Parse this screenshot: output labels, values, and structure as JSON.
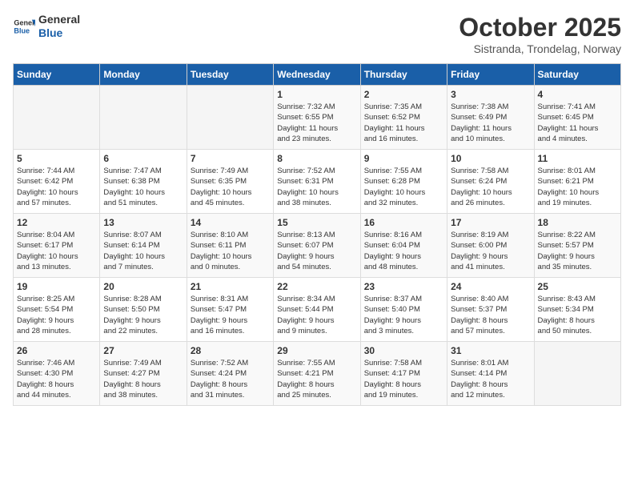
{
  "header": {
    "logo_line1": "General",
    "logo_line2": "Blue",
    "month": "October 2025",
    "location": "Sistranda, Trondelag, Norway"
  },
  "days_of_week": [
    "Sunday",
    "Monday",
    "Tuesday",
    "Wednesday",
    "Thursday",
    "Friday",
    "Saturday"
  ],
  "weeks": [
    [
      {
        "day": "",
        "content": ""
      },
      {
        "day": "",
        "content": ""
      },
      {
        "day": "",
        "content": ""
      },
      {
        "day": "1",
        "content": "Sunrise: 7:32 AM\nSunset: 6:55 PM\nDaylight: 11 hours\nand 23 minutes."
      },
      {
        "day": "2",
        "content": "Sunrise: 7:35 AM\nSunset: 6:52 PM\nDaylight: 11 hours\nand 16 minutes."
      },
      {
        "day": "3",
        "content": "Sunrise: 7:38 AM\nSunset: 6:49 PM\nDaylight: 11 hours\nand 10 minutes."
      },
      {
        "day": "4",
        "content": "Sunrise: 7:41 AM\nSunset: 6:45 PM\nDaylight: 11 hours\nand 4 minutes."
      }
    ],
    [
      {
        "day": "5",
        "content": "Sunrise: 7:44 AM\nSunset: 6:42 PM\nDaylight: 10 hours\nand 57 minutes."
      },
      {
        "day": "6",
        "content": "Sunrise: 7:47 AM\nSunset: 6:38 PM\nDaylight: 10 hours\nand 51 minutes."
      },
      {
        "day": "7",
        "content": "Sunrise: 7:49 AM\nSunset: 6:35 PM\nDaylight: 10 hours\nand 45 minutes."
      },
      {
        "day": "8",
        "content": "Sunrise: 7:52 AM\nSunset: 6:31 PM\nDaylight: 10 hours\nand 38 minutes."
      },
      {
        "day": "9",
        "content": "Sunrise: 7:55 AM\nSunset: 6:28 PM\nDaylight: 10 hours\nand 32 minutes."
      },
      {
        "day": "10",
        "content": "Sunrise: 7:58 AM\nSunset: 6:24 PM\nDaylight: 10 hours\nand 26 minutes."
      },
      {
        "day": "11",
        "content": "Sunrise: 8:01 AM\nSunset: 6:21 PM\nDaylight: 10 hours\nand 19 minutes."
      }
    ],
    [
      {
        "day": "12",
        "content": "Sunrise: 8:04 AM\nSunset: 6:17 PM\nDaylight: 10 hours\nand 13 minutes."
      },
      {
        "day": "13",
        "content": "Sunrise: 8:07 AM\nSunset: 6:14 PM\nDaylight: 10 hours\nand 7 minutes."
      },
      {
        "day": "14",
        "content": "Sunrise: 8:10 AM\nSunset: 6:11 PM\nDaylight: 10 hours\nand 0 minutes."
      },
      {
        "day": "15",
        "content": "Sunrise: 8:13 AM\nSunset: 6:07 PM\nDaylight: 9 hours\nand 54 minutes."
      },
      {
        "day": "16",
        "content": "Sunrise: 8:16 AM\nSunset: 6:04 PM\nDaylight: 9 hours\nand 48 minutes."
      },
      {
        "day": "17",
        "content": "Sunrise: 8:19 AM\nSunset: 6:00 PM\nDaylight: 9 hours\nand 41 minutes."
      },
      {
        "day": "18",
        "content": "Sunrise: 8:22 AM\nSunset: 5:57 PM\nDaylight: 9 hours\nand 35 minutes."
      }
    ],
    [
      {
        "day": "19",
        "content": "Sunrise: 8:25 AM\nSunset: 5:54 PM\nDaylight: 9 hours\nand 28 minutes."
      },
      {
        "day": "20",
        "content": "Sunrise: 8:28 AM\nSunset: 5:50 PM\nDaylight: 9 hours\nand 22 minutes."
      },
      {
        "day": "21",
        "content": "Sunrise: 8:31 AM\nSunset: 5:47 PM\nDaylight: 9 hours\nand 16 minutes."
      },
      {
        "day": "22",
        "content": "Sunrise: 8:34 AM\nSunset: 5:44 PM\nDaylight: 9 hours\nand 9 minutes."
      },
      {
        "day": "23",
        "content": "Sunrise: 8:37 AM\nSunset: 5:40 PM\nDaylight: 9 hours\nand 3 minutes."
      },
      {
        "day": "24",
        "content": "Sunrise: 8:40 AM\nSunset: 5:37 PM\nDaylight: 8 hours\nand 57 minutes."
      },
      {
        "day": "25",
        "content": "Sunrise: 8:43 AM\nSunset: 5:34 PM\nDaylight: 8 hours\nand 50 minutes."
      }
    ],
    [
      {
        "day": "26",
        "content": "Sunrise: 7:46 AM\nSunset: 4:30 PM\nDaylight: 8 hours\nand 44 minutes."
      },
      {
        "day": "27",
        "content": "Sunrise: 7:49 AM\nSunset: 4:27 PM\nDaylight: 8 hours\nand 38 minutes."
      },
      {
        "day": "28",
        "content": "Sunrise: 7:52 AM\nSunset: 4:24 PM\nDaylight: 8 hours\nand 31 minutes."
      },
      {
        "day": "29",
        "content": "Sunrise: 7:55 AM\nSunset: 4:21 PM\nDaylight: 8 hours\nand 25 minutes."
      },
      {
        "day": "30",
        "content": "Sunrise: 7:58 AM\nSunset: 4:17 PM\nDaylight: 8 hours\nand 19 minutes."
      },
      {
        "day": "31",
        "content": "Sunrise: 8:01 AM\nSunset: 4:14 PM\nDaylight: 8 hours\nand 12 minutes."
      },
      {
        "day": "",
        "content": ""
      }
    ]
  ]
}
